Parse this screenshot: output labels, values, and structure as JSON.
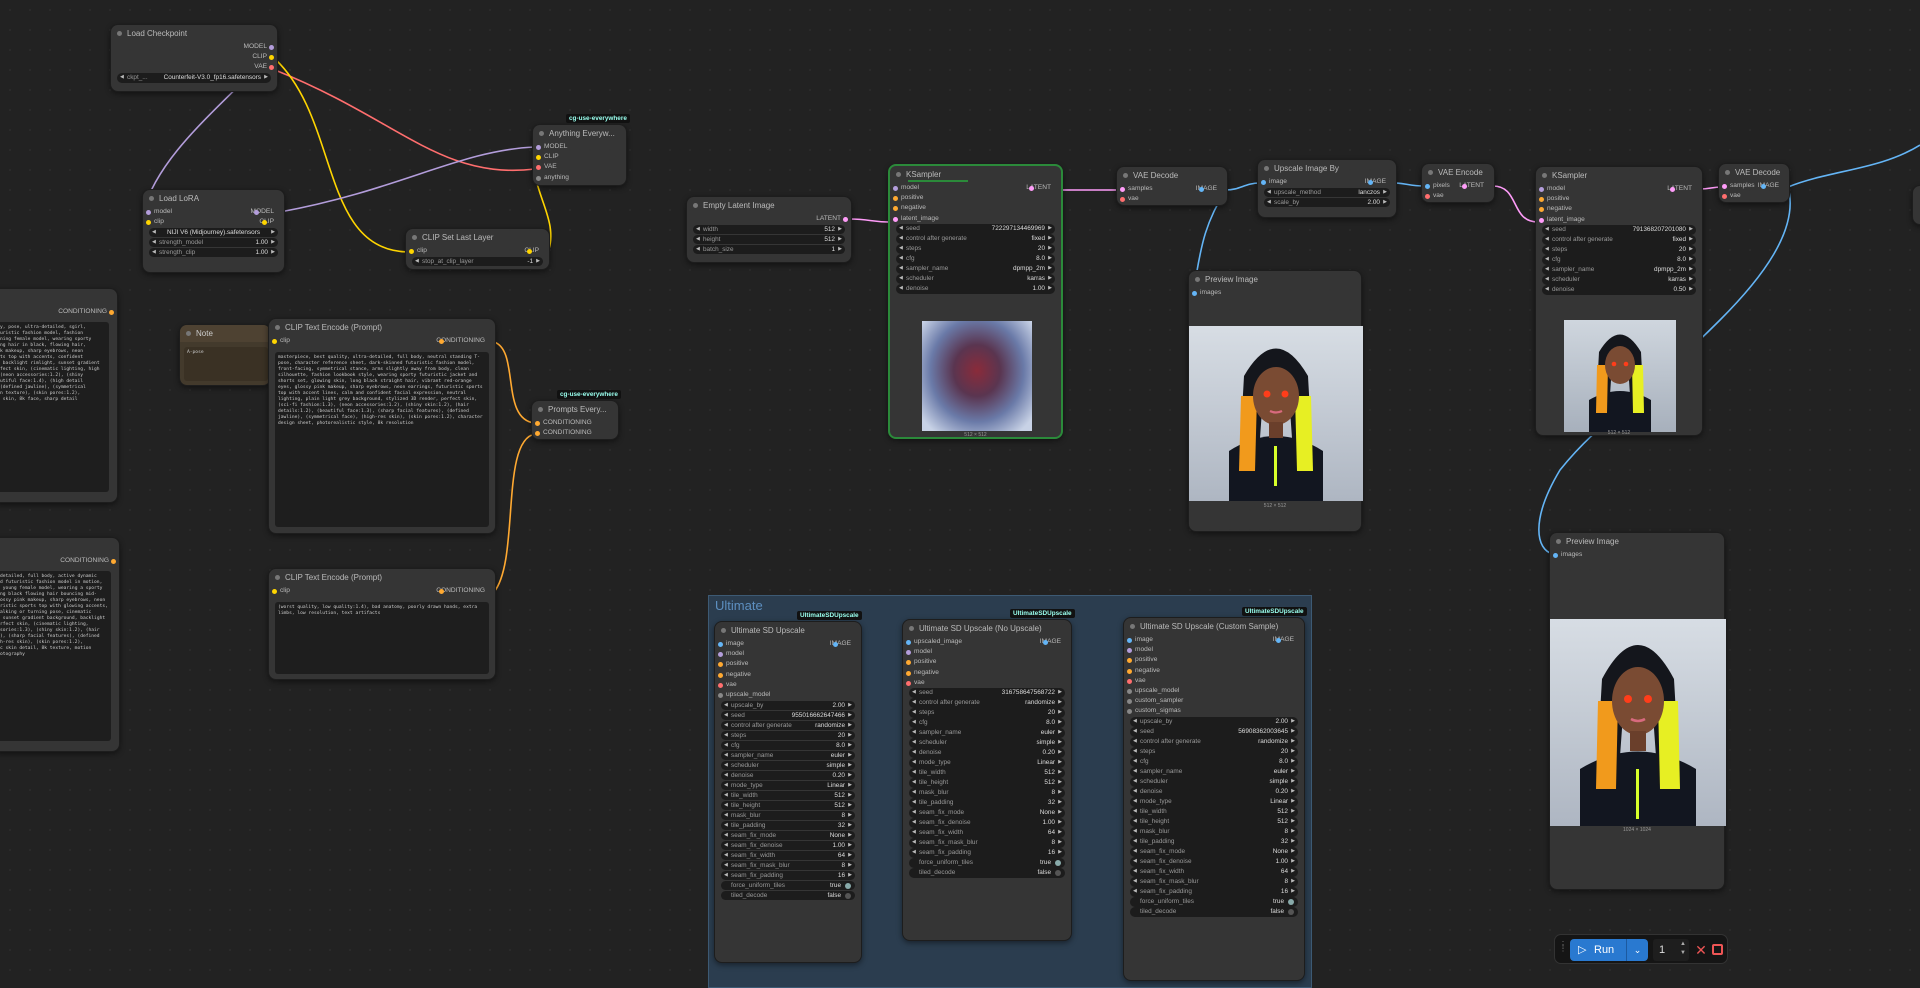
{
  "group": {
    "title": "Ultimate"
  },
  "badges": {
    "use_everywhere_1": "cg-use-everywhere",
    "use_everywhere_2": "cg-use-everywhere",
    "usd_1": "UltimateSDUpscale",
    "usd_2": "UltimateSDUpscale",
    "usd_3": "UltimateSDUpscale"
  },
  "checkpoint": {
    "title": "Load Checkpoint",
    "out_model": "MODEL",
    "out_clip": "CLIP",
    "out_vae": "VAE",
    "ckpt_label": "ckpt_...",
    "ckpt_value": "Counterfeit-V3.0_fp16.safetensors"
  },
  "lora": {
    "title": "Load LoRA",
    "in_model": "model",
    "in_clip": "clip",
    "out_model": "MODEL",
    "out_clip": "CLIP",
    "lora_value": "NIJI V6 (Midjourney).safetensors",
    "strength_model_label": "strength_model",
    "strength_model": "1.00",
    "strength_clip_label": "strength_clip",
    "strength_clip": "1.00"
  },
  "anything": {
    "title": "Anything Everyw...",
    "in_model": "MODEL",
    "in_clip": "CLIP",
    "in_vae": "VAE",
    "in_any": "anything"
  },
  "clipset": {
    "title": "CLIP Set Last Layer",
    "in_clip": "clip",
    "out_clip": "CLIP",
    "layer_label": "stop_at_clip_layer",
    "layer_value": "-1"
  },
  "note": {
    "title": "Note",
    "text": "A-pose"
  },
  "clip_pos": {
    "title": "CLIP Text Encode (Prompt)",
    "in_clip": "clip",
    "out": "CONDITIONING",
    "text": "masterpiece, best quality, ultra-detailed, full body, neutral standing T-pose, character reference sheet, dark-skinned futuristic fashion model, front-facing, symmetrical stance, arms slightly away from body, clean silhouette, fashion lookbook style, wearing sporty futuristic jacket and shorts set, glowing skin, long black straight hair, vibrant red-orange eyes, glossy pink makeup, sharp eyebrows, neon earrings, futuristic sports top with accent lines, calm and confident facial expression, neutral lighting, plain light grey background, stylized 3D render, perfect skin, (sci-fi fashion:1.3), (neon accessories:1.2), (shiny skin:1.2), (hair details:1.2), (beautiful face:1.3), (sharp facial features), (defined jawline), (symmetrical face), (high-res skin), (skin pores:1.2), character design sheet, photorealistic style, 8k resolution"
  },
  "clip_neg": {
    "title": "CLIP Text Encode (Prompt)",
    "in_clip": "clip",
    "out": "CONDITIONING",
    "text": "(worst quality, low quality:1.4), bad anatomy, poorly drawn hands, extra limbs, low resolution, text artifacts"
  },
  "prompts": {
    "title": "Prompts Every...",
    "in1": "CONDITIONING",
    "in2": "CONDITIONING"
  },
  "left1": {
    "out": "CONDITIONING",
    "text": "y, pose, ultra-detailed, sgirl,\nuristic fashion model, fashion\nning female model, wearing sporty\nng hair in black, flowing hair,\nk makeup, sharp eyebrows, neon\nts top with accents, confident\n backlight rimlight, sunset gradient\nfect skin, (cinematic lighting, high\n(neon accessories:1.2), (shiny\nutiful face:1.4), (high detail\n(defined jawline), (symmetrical\nn texture), (skin pores:1.2),\n skin, 8k face, sharp detail"
  },
  "left2": {
    "out": "CONDITIONING",
    "text": "detailed, full body, active dynamic\nd futuristic fashion model in motion,\n young female model, wearing a sporty\nng black flowing hair bouncing mid-\nossy pink makeup, sharp eyebrows, neon\nristic sports top with glowing accents,\nalking or turning pose, cinematic\n sunset gradient background, backlight\nrfect skin, (cinematic lighting,\nsories:1.3), (shiny skin:1.2), (hair\n), (sharp facial features), (defined\nh-res skin), (skin pores:1.2),\nc skin detail, 8k texture, motion\notography"
  },
  "empty_latent": {
    "title": "Empty Latent Image",
    "out": "LATENT",
    "width_label": "width",
    "width": "512",
    "height_label": "height",
    "height": "512",
    "batch_label": "batch_size",
    "batch": "1"
  },
  "ksampler1": {
    "title": "KSampler",
    "in_model": "model",
    "in_pos": "positive",
    "in_neg": "negative",
    "in_lat": "latent_image",
    "out": "LATENT",
    "seed_label": "seed",
    "seed": "722297134469969",
    "cag_label": "control after generate",
    "cag": "fixed",
    "steps_label": "steps",
    "steps": "20",
    "cfg_label": "cfg",
    "cfg": "8.0",
    "sampler_label": "sampler_name",
    "sampler": "dpmpp_2m",
    "scheduler_label": "scheduler",
    "scheduler": "karras",
    "denoise_label": "denoise",
    "denoise": "1.00",
    "caption": "512 × 512"
  },
  "vae_decode1": {
    "title": "VAE Decode",
    "in_samples": "samples",
    "in_vae": "vae",
    "out": "IMAGE"
  },
  "preview1": {
    "title": "Preview Image",
    "in": "images",
    "caption": "512 × 512"
  },
  "upscale_by": {
    "title": "Upscale Image By",
    "in": "image",
    "out": "IMAGE",
    "method_label": "upscale_method",
    "method": "lanczos",
    "scale_label": "scale_by",
    "scale": "2.00"
  },
  "vae_encode": {
    "title": "VAE Encode",
    "in_pixels": "pixels",
    "in_vae": "vae",
    "out": "LATENT"
  },
  "ksampler2": {
    "title": "KSampler",
    "in_model": "model",
    "in_pos": "positive",
    "in_neg": "negative",
    "in_lat": "latent_image",
    "out": "LATENT",
    "seed_label": "seed",
    "seed": "791368207201080",
    "cag_label": "control after generate",
    "cag": "fixed",
    "steps_label": "steps",
    "steps": "20",
    "cfg_label": "cfg",
    "cfg": "8.0",
    "sampler_label": "sampler_name",
    "sampler": "dpmpp_2m",
    "scheduler_label": "scheduler",
    "scheduler": "karras",
    "denoise_label": "denoise",
    "denoise": "0.50",
    "caption": "512 × 512"
  },
  "vae_decode2": {
    "title": "VAE Decode",
    "in_samples": "samples",
    "in_vae": "vae",
    "out": "IMAGE"
  },
  "preview2": {
    "title": "Preview Image",
    "in": "images",
    "caption": "1024 × 1024"
  },
  "usd1": {
    "title": "Ultimate SD Upscale",
    "inputs": [
      "image",
      "model",
      "positive",
      "negative",
      "vae",
      "upscale_model"
    ],
    "out": "IMAGE",
    "widgets": [
      [
        "upscale_by",
        "2.00"
      ],
      [
        "seed",
        "955016662647466"
      ],
      [
        "control after generate",
        "randomize"
      ],
      [
        "steps",
        "20"
      ],
      [
        "cfg",
        "8.0"
      ],
      [
        "sampler_name",
        "euler"
      ],
      [
        "scheduler",
        "simple"
      ],
      [
        "denoise",
        "0.20"
      ],
      [
        "mode_type",
        "Linear"
      ],
      [
        "tile_width",
        "512"
      ],
      [
        "tile_height",
        "512"
      ],
      [
        "mask_blur",
        "8"
      ],
      [
        "tile_padding",
        "32"
      ],
      [
        "seam_fix_mode",
        "None"
      ],
      [
        "seam_fix_denoise",
        "1.00"
      ],
      [
        "seam_fix_width",
        "64"
      ],
      [
        "seam_fix_mask_blur",
        "8"
      ],
      [
        "seam_fix_padding",
        "16"
      ]
    ],
    "toggles": [
      [
        "force_uniform_tiles",
        "true"
      ],
      [
        "tiled_decode",
        "false"
      ]
    ]
  },
  "usd2": {
    "title": "Ultimate SD Upscale (No Upscale)",
    "inputs": [
      "upscaled_image",
      "model",
      "positive",
      "negative",
      "vae"
    ],
    "out": "IMAGE",
    "widgets": [
      [
        "seed",
        "316758647568722"
      ],
      [
        "control after generate",
        "randomize"
      ],
      [
        "steps",
        "20"
      ],
      [
        "cfg",
        "8.0"
      ],
      [
        "sampler_name",
        "euler"
      ],
      [
        "scheduler",
        "simple"
      ],
      [
        "denoise",
        "0.20"
      ],
      [
        "mode_type",
        "Linear"
      ],
      [
        "tile_width",
        "512"
      ],
      [
        "tile_height",
        "512"
      ],
      [
        "mask_blur",
        "8"
      ],
      [
        "tile_padding",
        "32"
      ],
      [
        "seam_fix_mode",
        "None"
      ],
      [
        "seam_fix_denoise",
        "1.00"
      ],
      [
        "seam_fix_width",
        "64"
      ],
      [
        "seam_fix_mask_blur",
        "8"
      ],
      [
        "seam_fix_padding",
        "16"
      ]
    ],
    "toggles": [
      [
        "force_uniform_tiles",
        "true"
      ],
      [
        "tiled_decode",
        "false"
      ]
    ]
  },
  "usd3": {
    "title": "Ultimate SD Upscale (Custom Sample)",
    "inputs": [
      "image",
      "model",
      "positive",
      "negative",
      "vae",
      "upscale_model",
      "custom_sampler",
      "custom_sigmas"
    ],
    "out": "IMAGE",
    "widgets": [
      [
        "upscale_by",
        "2.00"
      ],
      [
        "seed",
        "56908362003645"
      ],
      [
        "control after generate",
        "randomize"
      ],
      [
        "steps",
        "20"
      ],
      [
        "cfg",
        "8.0"
      ],
      [
        "sampler_name",
        "euler"
      ],
      [
        "scheduler",
        "simple"
      ],
      [
        "denoise",
        "0.20"
      ],
      [
        "mode_type",
        "Linear"
      ],
      [
        "tile_width",
        "512"
      ],
      [
        "tile_height",
        "512"
      ],
      [
        "mask_blur",
        "8"
      ],
      [
        "tile_padding",
        "32"
      ],
      [
        "seam_fix_mode",
        "None"
      ],
      [
        "seam_fix_denoise",
        "1.00"
      ],
      [
        "seam_fix_width",
        "64"
      ],
      [
        "seam_fix_mask_blur",
        "8"
      ],
      [
        "seam_fix_padding",
        "16"
      ]
    ],
    "toggles": [
      [
        "force_uniform_tiles",
        "true"
      ],
      [
        "tiled_decode",
        "false"
      ]
    ]
  },
  "toolbar": {
    "run_label": "Run",
    "queue_count": "1",
    "run_icon": "play-icon",
    "dropdown_icon": "chevron-down-icon",
    "cancel_icon": "close-icon",
    "stop_icon": "stop-icon"
  },
  "colors": {
    "model": "#b39ddb",
    "clip": "#ffd500",
    "vae": "#ff6e6e",
    "conditioning": "#ffa931",
    "latent": "#ff9cf9",
    "image": "#64b5f6",
    "run": "#2979d0",
    "selected": "#2b8a3a"
  }
}
